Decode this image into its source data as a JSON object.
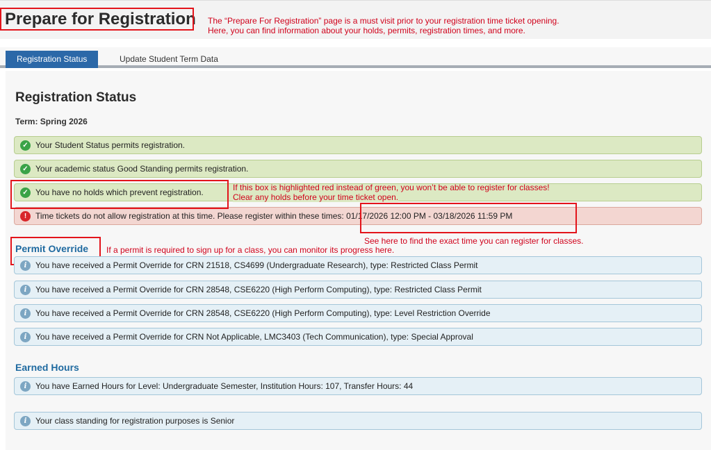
{
  "header": {
    "title": "Prepare for Registration",
    "annotation_line1": "The “Prepare For Registration” page is a must visit prior to your registration time ticket opening.",
    "annotation_line2": "Here, you can find information about your holds, permits, registration times, and more."
  },
  "tabs": [
    {
      "label": "Registration Status",
      "active": true
    },
    {
      "label": "Update Student Term Data",
      "active": false
    }
  ],
  "status": {
    "heading": "Registration Status",
    "term": "Term: Spring 2026",
    "messages": [
      {
        "type": "success",
        "icon": "check-circle-icon",
        "text": "Your Student Status permits registration."
      },
      {
        "type": "success",
        "icon": "check-circle-icon",
        "text": "Your academic status Good Standing permits registration."
      },
      {
        "type": "success",
        "icon": "check-circle-icon",
        "text": "You have no holds which prevent registration."
      },
      {
        "type": "error",
        "icon": "exclamation-icon",
        "text": "Time tickets do not allow registration at this time. Please register within these times: 01/17/2026 12:00 PM - 03/18/2026 11:59 PM"
      }
    ]
  },
  "annotations": {
    "holds_line1": "If this box is highlighted red instead of green, you won’t be able to register for classes!",
    "holds_line2": "Clear any holds before your time ticket open.",
    "time": "See here to find the exact time you can register for classes.",
    "permit": "If a permit is required to sign up for a class, you can monitor its progress here."
  },
  "permit_override": {
    "heading": "Permit Override",
    "items": [
      "You have received a Permit Override for CRN 21518, CS4699 (Undergraduate Research), type: Restricted Class Permit",
      "You have received a Permit Override for CRN 28548, CSE6220 (High Perform Computing), type: Restricted Class Permit",
      "You have received a Permit Override for CRN 28548, CSE6220 (High Perform Computing), type: Level Restriction Override",
      "You have received a Permit Override for CRN Not Applicable, LMC3403 (Tech Communication), type: Special Approval"
    ]
  },
  "earned_hours": {
    "heading": "Earned Hours",
    "items": [
      "You have Earned Hours for Level: Undergraduate Semester, Institution Hours: 107, Transfer Hours: 44",
      "Your class standing for registration purposes is Senior"
    ]
  },
  "colors": {
    "accent": "#2b68a8",
    "success_bg": "#dce9c3",
    "error_bg": "#f3d6d1",
    "info_bg": "#e5f0f6",
    "annotation": "#e3141b"
  }
}
